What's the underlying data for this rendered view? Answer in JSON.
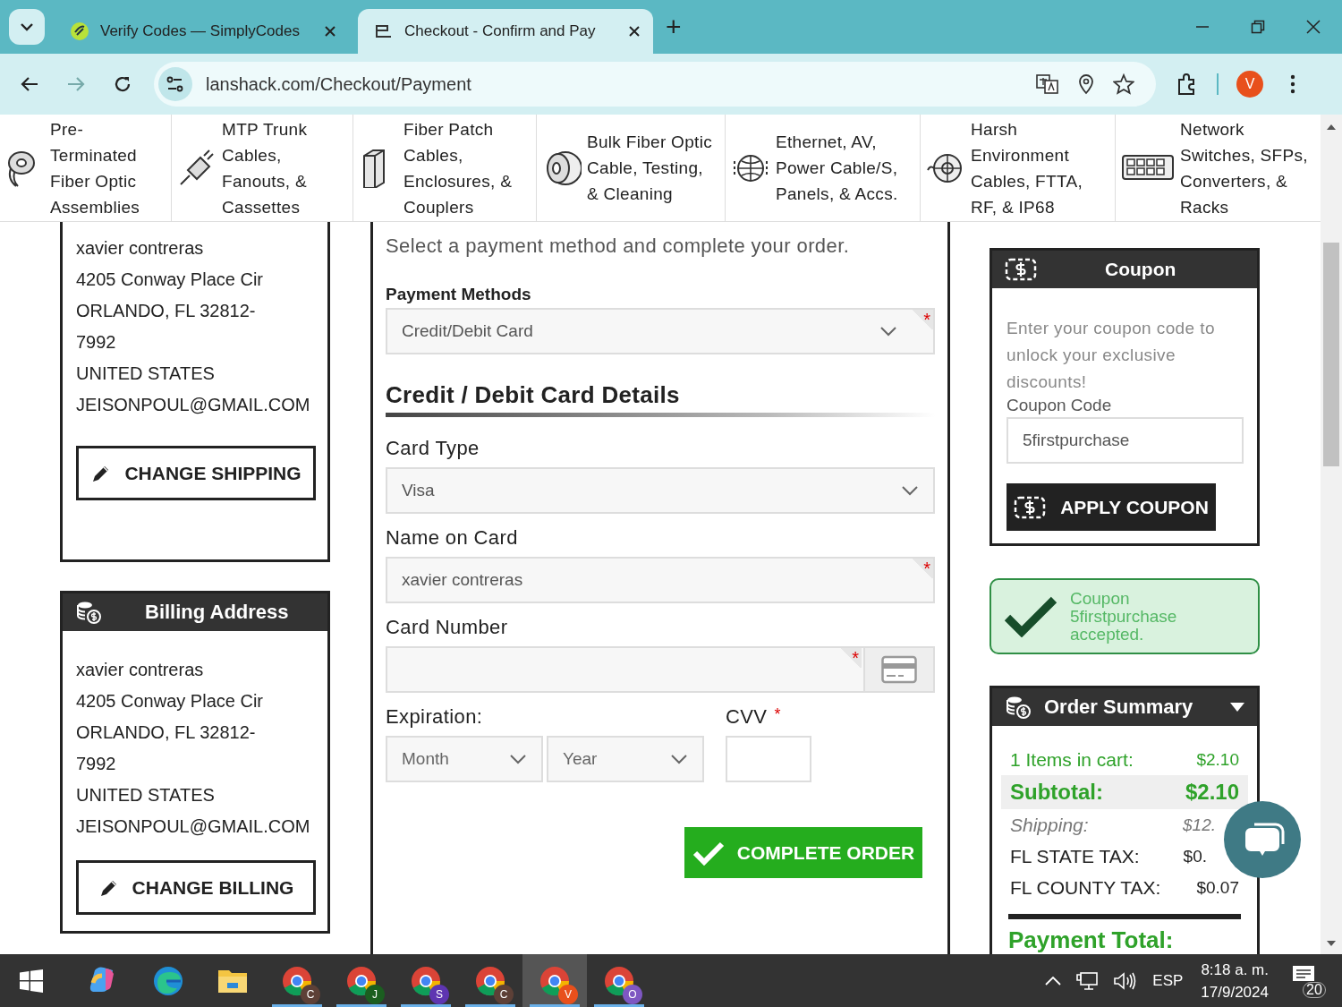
{
  "browser": {
    "tabs": [
      {
        "title": "Verify Codes — SimplyCodes",
        "kind": "leaf",
        "selected": false
      },
      {
        "title": "Checkout - Confirm and Pay",
        "kind": "cable",
        "selected": true
      }
    ],
    "new_tab": "+",
    "url": "lanshack.com/Checkout/Payment",
    "profile": "V"
  },
  "categories": [
    {
      "label": "Pre-\nTerminated\nFiber Optic\nAssemblies",
      "kind": "spool"
    },
    {
      "label": "MTP Trunk\nCables,\nFanouts, &\nCassettes",
      "kind": "plug"
    },
    {
      "label": "Fiber Patch\nCables,\nEnclosures, &\nCouplers",
      "kind": "enclosure"
    },
    {
      "label": "Bulk Fiber Optic\nCable, Testing,\n& Cleaning",
      "kind": "reel"
    },
    {
      "label": "Ethernet, AV,\nPower Cable/S,\nPanels, & Accs.",
      "kind": "globe"
    },
    {
      "label": "Harsh\nEnvironment\nCables, FTTA,\nRF, & IP68",
      "kind": "drum"
    },
    {
      "label": "Network\nSwitches, SFPs,\nConverters, &\nRacks",
      "kind": "switch"
    }
  ],
  "shipping": {
    "lines": [
      "xavier contreras",
      "4205 Conway Place Cir",
      "ORLANDO, FL 32812-\n7992",
      "UNITED STATES",
      "JEISONPOUL@GMAIL.COM"
    ],
    "button": "CHANGE SHIPPING"
  },
  "billing": {
    "title": "Billing Address",
    "lines": [
      "xavier contreras",
      "4205 Conway Place Cir",
      "ORLANDO, FL 32812-\n7992",
      "UNITED STATES",
      "JEISONPOUL@GMAIL.COM"
    ],
    "button": "CHANGE BILLING"
  },
  "payment": {
    "intro": "Select a payment method and complete your order.",
    "method_label": "Payment Methods",
    "method": {
      "value": "Credit/Debit Card",
      "required_mark": "*"
    },
    "section_title": "Credit / Debit Card Details",
    "fields": [
      {
        "label": "Card Type",
        "kind": "select",
        "value": "Visa"
      },
      {
        "label": "Name on Card",
        "kind": "text",
        "value": "xavier contreras",
        "required_mark": "*"
      },
      {
        "label": "Card Number",
        "kind": "card",
        "required_mark": "*"
      }
    ],
    "expiration_label": "Expiration:",
    "month": {
      "placeholder": "Month"
    },
    "year": {
      "placeholder": "Year"
    },
    "cvv_label": "CVV",
    "cvv_mark": "*",
    "submit": "COMPLETE ORDER"
  },
  "coupon": {
    "title": "Coupon",
    "text": "Enter your coupon code to unlock your exclusive discounts!",
    "label": "Coupon Code",
    "value": "5firstpurchase",
    "button": "APPLY COUPON",
    "message": "Coupon 5firstpurchase accepted."
  },
  "summary": {
    "title": "Order Summary",
    "rows": [
      {
        "label": "1 Items in cart:",
        "value": "$2.10",
        "kind": "items"
      },
      {
        "label": "Subtotal:",
        "value": "$2.10",
        "kind": "subtotal"
      },
      {
        "label": "Shipping:",
        "value": "$12.",
        "kind": "shipping"
      },
      {
        "label": "FL STATE TAX:",
        "value": "$0.",
        "kind": "tax"
      },
      {
        "label": "FL COUNTY TAX:",
        "value": "$0.07",
        "kind": "tax"
      }
    ],
    "total_label": "Payment Total:"
  },
  "taskbar": {
    "apps": [
      {
        "kind": "copilot",
        "selected": false
      },
      {
        "kind": "edge",
        "selected": false
      },
      {
        "kind": "folder",
        "selected": false
      },
      {
        "kind": "chrome",
        "badge": "C",
        "color": "#5d4037",
        "selected": false
      },
      {
        "kind": "chrome",
        "badge": "J",
        "color": "#1b5e20",
        "selected": false
      },
      {
        "kind": "chrome",
        "badge": "S",
        "color": "#5e35b1",
        "selected": false
      },
      {
        "kind": "chrome",
        "badge": "C",
        "color": "#5d4037",
        "selected": false
      },
      {
        "kind": "chrome",
        "badge": "V",
        "color": "#e8501c",
        "selected": true
      },
      {
        "kind": "chrome",
        "badge": "O",
        "color": "#7e57c2",
        "selected": false
      }
    ],
    "language": "ESP",
    "time": "8:18 a. m.",
    "date": "17/9/2024",
    "notifications": "20"
  }
}
